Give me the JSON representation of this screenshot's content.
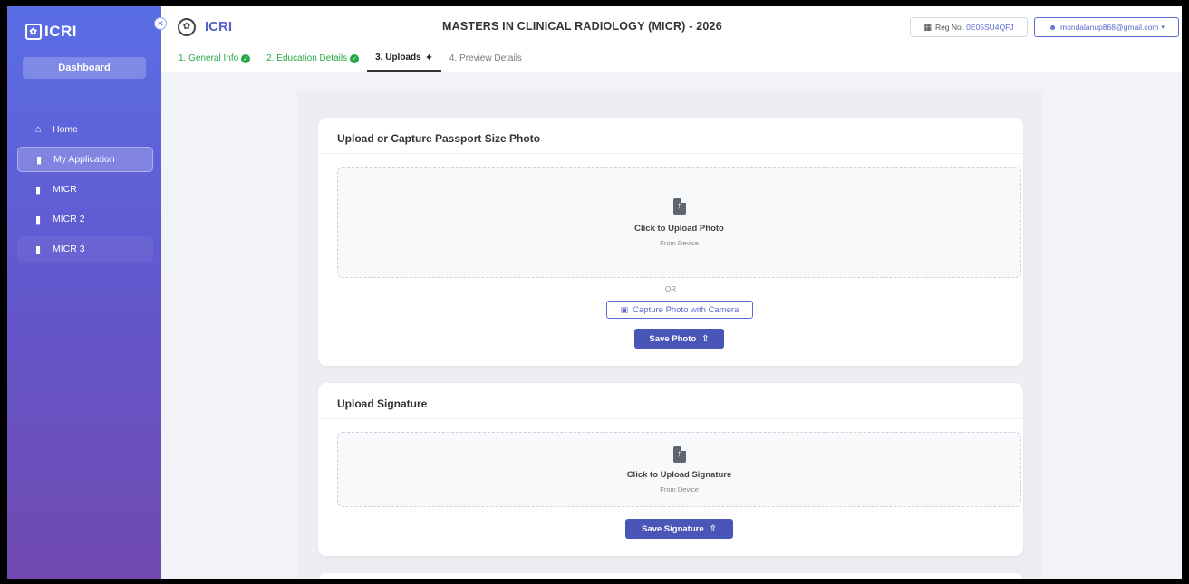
{
  "sidebar": {
    "brand": "ICRI",
    "dashboard_label": "Dashboard",
    "items": [
      {
        "label": "Home",
        "icon": "home-icon"
      },
      {
        "label": "My Application",
        "icon": "document-icon"
      },
      {
        "label": "MICR",
        "icon": "document-icon"
      },
      {
        "label": "MICR 2",
        "icon": "document-icon"
      },
      {
        "label": "MICR 3",
        "icon": "document-icon"
      }
    ]
  },
  "header": {
    "brand": "ICRI",
    "title": "MASTERS IN CLINICAL RADIOLOGY (MICR) - 2026",
    "reg_label": "Reg No.",
    "reg_value": "0E05SU4QFJ",
    "user_email": "mondalanup868@gmail.com"
  },
  "tabs": [
    {
      "label": "1. General Info",
      "state": "done"
    },
    {
      "label": "2. Education Details",
      "state": "done"
    },
    {
      "label": "3. Uploads",
      "state": "current"
    },
    {
      "label": "4. Preview Details",
      "state": "pending"
    }
  ],
  "photo_section": {
    "title": "Upload or Capture Passport Size Photo",
    "drop_title": "Click to Upload Photo",
    "drop_sub": "From Device",
    "or_text": "OR",
    "camera_label": "Capture Photo with Camera",
    "save_label": "Save Photo"
  },
  "signature_section": {
    "title": "Upload Signature",
    "drop_title": "Click to Upload Signature",
    "drop_sub": "From Device",
    "save_label": "Save Signature"
  },
  "colors": {
    "accent": "#4a55b8",
    "success": "#27a745"
  }
}
